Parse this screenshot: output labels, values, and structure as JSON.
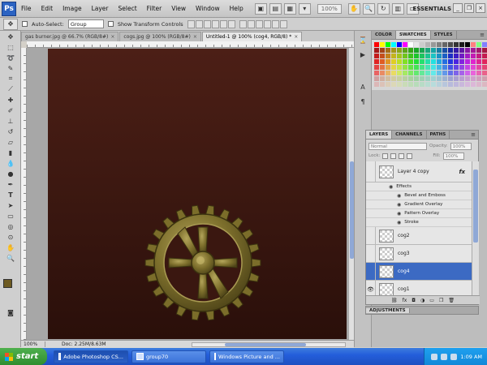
{
  "app": {
    "logo": "Ps"
  },
  "menu": [
    "File",
    "Edit",
    "Image",
    "Layer",
    "Select",
    "Filter",
    "View",
    "Window",
    "Help"
  ],
  "menubar": {
    "zoom": "100%",
    "workspace": "ESSENTIALS"
  },
  "options": {
    "auto_select_label": "Auto-Select:",
    "auto_select_value": "Group",
    "transform_label": "Show Transform Controls"
  },
  "doc_tabs": [
    {
      "label": "gas burner.jpg @ 66.7% (RGB/8#)",
      "close": "×"
    },
    {
      "label": "cogs.jpg @ 100% (RGB/8#)",
      "close": "×"
    },
    {
      "label": "Untitled-1 @ 100% (cog4, RGB/8) *",
      "close": "×"
    }
  ],
  "status": {
    "zoom": "100%",
    "doc_size": "Doc: 2.25M/8.63M"
  },
  "swatches_panel": {
    "tabs": [
      "COLOR",
      "SWATCHES",
      "STYLES"
    ],
    "active": 1
  },
  "layers_panel": {
    "tabs": [
      "LAYERS",
      "CHANNELS",
      "PATHS"
    ],
    "blend_mode": "Normal",
    "opacity_label": "Opacity:",
    "opacity_value": "100%",
    "lock_label": "Lock:",
    "fill_label": "Fill:",
    "fill_value": "100%",
    "layers": [
      {
        "name": "Layer 4 copy",
        "fx": "fx",
        "selected": false
      },
      {
        "name": "cog2",
        "selected": false
      },
      {
        "name": "cog3",
        "selected": false
      },
      {
        "name": "cog4",
        "selected": true
      },
      {
        "name": "cog1",
        "selected": false
      }
    ],
    "effects_label": "Effects",
    "effects": [
      "Bevel and Emboss",
      "Gradient Overlay",
      "Pattern Overlay",
      "Stroke"
    ]
  },
  "adjustments": {
    "tab": "ADJUSTMENTS"
  },
  "taskbar": {
    "start": "start",
    "items": [
      {
        "label": "Adobe Photoshop CS...",
        "active": true
      },
      {
        "label": "group70",
        "active": false
      },
      {
        "label": "Windows Picture and ...",
        "active": false
      }
    ],
    "clock": "1:09 AM"
  },
  "colors": {
    "foreground": "#6d5a21",
    "background": "#4a3c12",
    "selection": "#3c6ac3"
  }
}
